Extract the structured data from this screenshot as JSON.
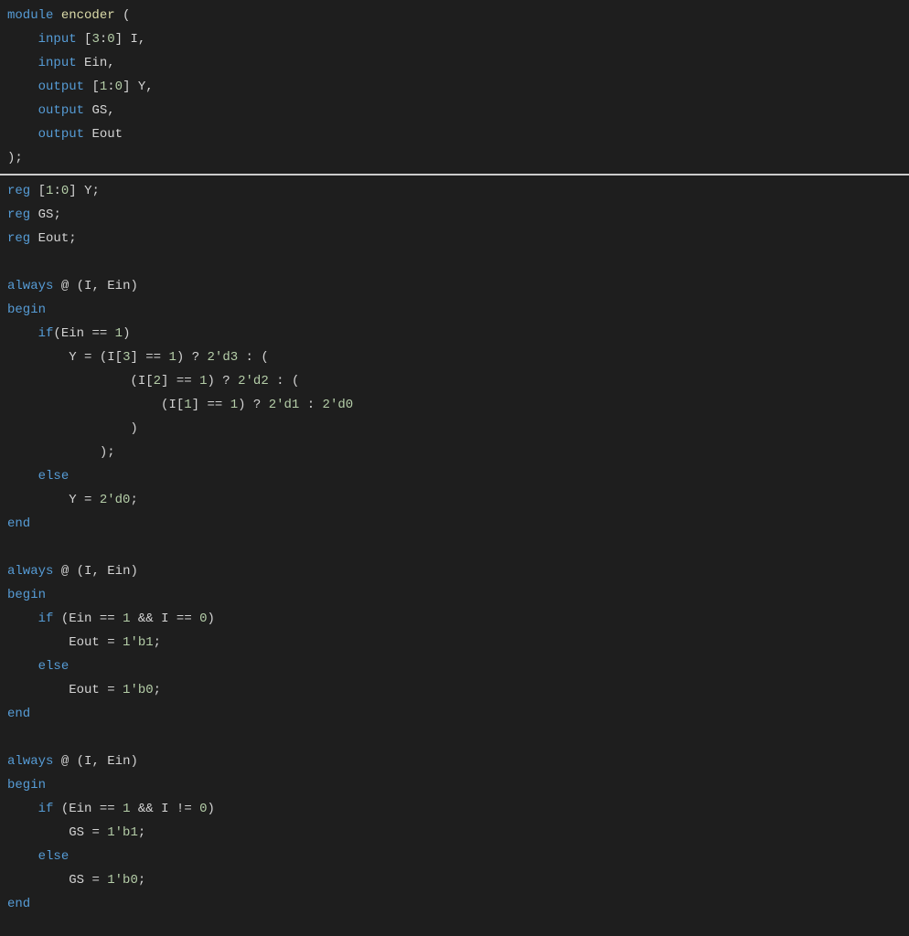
{
  "code": {
    "header": [
      {
        "kind": "line",
        "tokens": [
          [
            "kw",
            "module"
          ],
          [
            "sp",
            " "
          ],
          [
            "ent",
            "encoder"
          ],
          [
            "sp",
            " "
          ],
          [
            "pn",
            "("
          ]
        ]
      },
      {
        "kind": "line",
        "tokens": [
          [
            "sp",
            "    "
          ],
          [
            "kw",
            "input"
          ],
          [
            "sp",
            " "
          ],
          [
            "pn",
            "["
          ],
          [
            "num",
            "3"
          ],
          [
            "op",
            ":"
          ],
          [
            "num",
            "0"
          ],
          [
            "pn",
            "]"
          ],
          [
            "sp",
            " "
          ],
          [
            "id",
            "I"
          ],
          [
            "pn",
            ","
          ]
        ]
      },
      {
        "kind": "line",
        "tokens": [
          [
            "sp",
            "    "
          ],
          [
            "kw",
            "input"
          ],
          [
            "sp",
            " "
          ],
          [
            "id",
            "Ein"
          ],
          [
            "pn",
            ","
          ]
        ]
      },
      {
        "kind": "line",
        "tokens": [
          [
            "sp",
            "    "
          ],
          [
            "kw",
            "output"
          ],
          [
            "sp",
            " "
          ],
          [
            "pn",
            "["
          ],
          [
            "num",
            "1"
          ],
          [
            "op",
            ":"
          ],
          [
            "num",
            "0"
          ],
          [
            "pn",
            "]"
          ],
          [
            "sp",
            " "
          ],
          [
            "id",
            "Y"
          ],
          [
            "pn",
            ","
          ]
        ]
      },
      {
        "kind": "line",
        "tokens": [
          [
            "sp",
            "    "
          ],
          [
            "kw",
            "output"
          ],
          [
            "sp",
            " "
          ],
          [
            "id",
            "GS"
          ],
          [
            "pn",
            ","
          ]
        ]
      },
      {
        "kind": "line",
        "tokens": [
          [
            "sp",
            "    "
          ],
          [
            "kw",
            "output"
          ],
          [
            "sp",
            " "
          ],
          [
            "id",
            "Eout"
          ]
        ]
      },
      {
        "kind": "line",
        "tokens": [
          [
            "pn",
            ")"
          ],
          [
            "pn",
            ";"
          ]
        ]
      }
    ],
    "body": [
      {
        "kind": "line",
        "tokens": [
          [
            "kw",
            "reg"
          ],
          [
            "sp",
            " "
          ],
          [
            "pn",
            "["
          ],
          [
            "num",
            "1"
          ],
          [
            "op",
            ":"
          ],
          [
            "num",
            "0"
          ],
          [
            "pn",
            "]"
          ],
          [
            "sp",
            " "
          ],
          [
            "id",
            "Y"
          ],
          [
            "pn",
            ";"
          ]
        ]
      },
      {
        "kind": "line",
        "tokens": [
          [
            "kw",
            "reg"
          ],
          [
            "sp",
            " "
          ],
          [
            "id",
            "GS"
          ],
          [
            "pn",
            ";"
          ]
        ]
      },
      {
        "kind": "line",
        "tokens": [
          [
            "kw",
            "reg"
          ],
          [
            "sp",
            " "
          ],
          [
            "id",
            "Eout"
          ],
          [
            "pn",
            ";"
          ]
        ]
      },
      {
        "kind": "blank"
      },
      {
        "kind": "line",
        "tokens": [
          [
            "kw",
            "always"
          ],
          [
            "sp",
            " "
          ],
          [
            "op",
            "@"
          ],
          [
            "sp",
            " "
          ],
          [
            "pn",
            "("
          ],
          [
            "id",
            "I"
          ],
          [
            "pn",
            ","
          ],
          [
            "sp",
            " "
          ],
          [
            "id",
            "Ein"
          ],
          [
            "pn",
            ")"
          ]
        ]
      },
      {
        "kind": "line",
        "tokens": [
          [
            "kw",
            "begin"
          ]
        ]
      },
      {
        "kind": "line",
        "tokens": [
          [
            "sp",
            "    "
          ],
          [
            "kw",
            "if"
          ],
          [
            "pn",
            "("
          ],
          [
            "id",
            "Ein"
          ],
          [
            "sp",
            " "
          ],
          [
            "op",
            "=="
          ],
          [
            "sp",
            " "
          ],
          [
            "num",
            "1"
          ],
          [
            "pn",
            ")"
          ]
        ]
      },
      {
        "kind": "line",
        "tokens": [
          [
            "sp",
            "        "
          ],
          [
            "id",
            "Y"
          ],
          [
            "sp",
            " "
          ],
          [
            "op",
            "="
          ],
          [
            "sp",
            " "
          ],
          [
            "pn",
            "("
          ],
          [
            "id",
            "I"
          ],
          [
            "pn",
            "["
          ],
          [
            "num",
            "3"
          ],
          [
            "pn",
            "]"
          ],
          [
            "sp",
            " "
          ],
          [
            "op",
            "=="
          ],
          [
            "sp",
            " "
          ],
          [
            "num",
            "1"
          ],
          [
            "pn",
            ")"
          ],
          [
            "sp",
            " "
          ],
          [
            "op",
            "?"
          ],
          [
            "sp",
            " "
          ],
          [
            "num",
            "2'd3"
          ],
          [
            "sp",
            " "
          ],
          [
            "op",
            ":"
          ],
          [
            "sp",
            " "
          ],
          [
            "pn",
            "("
          ]
        ]
      },
      {
        "kind": "line",
        "tokens": [
          [
            "sp",
            "                "
          ],
          [
            "pn",
            "("
          ],
          [
            "id",
            "I"
          ],
          [
            "pn",
            "["
          ],
          [
            "num",
            "2"
          ],
          [
            "pn",
            "]"
          ],
          [
            "sp",
            " "
          ],
          [
            "op",
            "=="
          ],
          [
            "sp",
            " "
          ],
          [
            "num",
            "1"
          ],
          [
            "pn",
            ")"
          ],
          [
            "sp",
            " "
          ],
          [
            "op",
            "?"
          ],
          [
            "sp",
            " "
          ],
          [
            "num",
            "2'd2"
          ],
          [
            "sp",
            " "
          ],
          [
            "op",
            ":"
          ],
          [
            "sp",
            " "
          ],
          [
            "pn",
            "("
          ]
        ]
      },
      {
        "kind": "line",
        "tokens": [
          [
            "sp",
            "                    "
          ],
          [
            "pn",
            "("
          ],
          [
            "id",
            "I"
          ],
          [
            "pn",
            "["
          ],
          [
            "num",
            "1"
          ],
          [
            "pn",
            "]"
          ],
          [
            "sp",
            " "
          ],
          [
            "op",
            "=="
          ],
          [
            "sp",
            " "
          ],
          [
            "num",
            "1"
          ],
          [
            "pn",
            ")"
          ],
          [
            "sp",
            " "
          ],
          [
            "op",
            "?"
          ],
          [
            "sp",
            " "
          ],
          [
            "num",
            "2'd1"
          ],
          [
            "sp",
            " "
          ],
          [
            "op",
            ":"
          ],
          [
            "sp",
            " "
          ],
          [
            "num",
            "2'd0"
          ]
        ]
      },
      {
        "kind": "line",
        "tokens": [
          [
            "sp",
            "                "
          ],
          [
            "pn",
            ")"
          ]
        ]
      },
      {
        "kind": "line",
        "tokens": [
          [
            "sp",
            "            "
          ],
          [
            "pn",
            ")"
          ],
          [
            "pn",
            ";"
          ]
        ]
      },
      {
        "kind": "line",
        "tokens": [
          [
            "sp",
            "    "
          ],
          [
            "kw",
            "else"
          ]
        ]
      },
      {
        "kind": "line",
        "tokens": [
          [
            "sp",
            "        "
          ],
          [
            "id",
            "Y"
          ],
          [
            "sp",
            " "
          ],
          [
            "op",
            "="
          ],
          [
            "sp",
            " "
          ],
          [
            "num",
            "2'd0"
          ],
          [
            "pn",
            ";"
          ]
        ]
      },
      {
        "kind": "line",
        "tokens": [
          [
            "kw",
            "end"
          ]
        ]
      },
      {
        "kind": "blank"
      },
      {
        "kind": "line",
        "tokens": [
          [
            "kw",
            "always"
          ],
          [
            "sp",
            " "
          ],
          [
            "op",
            "@"
          ],
          [
            "sp",
            " "
          ],
          [
            "pn",
            "("
          ],
          [
            "id",
            "I"
          ],
          [
            "pn",
            ","
          ],
          [
            "sp",
            " "
          ],
          [
            "id",
            "Ein"
          ],
          [
            "pn",
            ")"
          ]
        ]
      },
      {
        "kind": "line",
        "tokens": [
          [
            "kw",
            "begin"
          ]
        ]
      },
      {
        "kind": "line",
        "tokens": [
          [
            "sp",
            "    "
          ],
          [
            "kw",
            "if"
          ],
          [
            "sp",
            " "
          ],
          [
            "pn",
            "("
          ],
          [
            "id",
            "Ein"
          ],
          [
            "sp",
            " "
          ],
          [
            "op",
            "=="
          ],
          [
            "sp",
            " "
          ],
          [
            "num",
            "1"
          ],
          [
            "sp",
            " "
          ],
          [
            "op",
            "&&"
          ],
          [
            "sp",
            " "
          ],
          [
            "id",
            "I"
          ],
          [
            "sp",
            " "
          ],
          [
            "op",
            "=="
          ],
          [
            "sp",
            " "
          ],
          [
            "num",
            "0"
          ],
          [
            "pn",
            ")"
          ]
        ]
      },
      {
        "kind": "line",
        "tokens": [
          [
            "sp",
            "        "
          ],
          [
            "id",
            "Eout"
          ],
          [
            "sp",
            " "
          ],
          [
            "op",
            "="
          ],
          [
            "sp",
            " "
          ],
          [
            "num",
            "1'b1"
          ],
          [
            "pn",
            ";"
          ]
        ]
      },
      {
        "kind": "line",
        "tokens": [
          [
            "sp",
            "    "
          ],
          [
            "kw",
            "else"
          ]
        ]
      },
      {
        "kind": "line",
        "tokens": [
          [
            "sp",
            "        "
          ],
          [
            "id",
            "Eout"
          ],
          [
            "sp",
            " "
          ],
          [
            "op",
            "="
          ],
          [
            "sp",
            " "
          ],
          [
            "num",
            "1'b0"
          ],
          [
            "pn",
            ";"
          ]
        ]
      },
      {
        "kind": "line",
        "tokens": [
          [
            "kw",
            "end"
          ]
        ]
      },
      {
        "kind": "blank"
      },
      {
        "kind": "line",
        "tokens": [
          [
            "kw",
            "always"
          ],
          [
            "sp",
            " "
          ],
          [
            "op",
            "@"
          ],
          [
            "sp",
            " "
          ],
          [
            "pn",
            "("
          ],
          [
            "id",
            "I"
          ],
          [
            "pn",
            ","
          ],
          [
            "sp",
            " "
          ],
          [
            "id",
            "Ein"
          ],
          [
            "pn",
            ")"
          ]
        ]
      },
      {
        "kind": "line",
        "tokens": [
          [
            "kw",
            "begin"
          ]
        ]
      },
      {
        "kind": "line",
        "tokens": [
          [
            "sp",
            "    "
          ],
          [
            "kw",
            "if"
          ],
          [
            "sp",
            " "
          ],
          [
            "pn",
            "("
          ],
          [
            "id",
            "Ein"
          ],
          [
            "sp",
            " "
          ],
          [
            "op",
            "=="
          ],
          [
            "sp",
            " "
          ],
          [
            "num",
            "1"
          ],
          [
            "sp",
            " "
          ],
          [
            "op",
            "&&"
          ],
          [
            "sp",
            " "
          ],
          [
            "id",
            "I"
          ],
          [
            "sp",
            " "
          ],
          [
            "op",
            "!="
          ],
          [
            "sp",
            " "
          ],
          [
            "num",
            "0"
          ],
          [
            "pn",
            ")"
          ]
        ]
      },
      {
        "kind": "line",
        "tokens": [
          [
            "sp",
            "        "
          ],
          [
            "id",
            "GS"
          ],
          [
            "sp",
            " "
          ],
          [
            "op",
            "="
          ],
          [
            "sp",
            " "
          ],
          [
            "num",
            "1'b1"
          ],
          [
            "pn",
            ";"
          ]
        ]
      },
      {
        "kind": "line",
        "tokens": [
          [
            "sp",
            "    "
          ],
          [
            "kw",
            "else"
          ]
        ]
      },
      {
        "kind": "line",
        "tokens": [
          [
            "sp",
            "        "
          ],
          [
            "id",
            "GS"
          ],
          [
            "sp",
            " "
          ],
          [
            "op",
            "="
          ],
          [
            "sp",
            " "
          ],
          [
            "num",
            "1'b0"
          ],
          [
            "pn",
            ";"
          ]
        ]
      },
      {
        "kind": "line",
        "tokens": [
          [
            "kw",
            "end"
          ]
        ]
      }
    ]
  }
}
